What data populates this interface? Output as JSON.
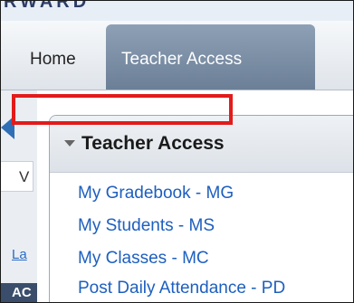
{
  "banner": {
    "text": "RWARD"
  },
  "nav": {
    "home_label": "Home",
    "teacher_access_label": "Teacher Access"
  },
  "left_column": {
    "tab_letter": "V",
    "link_fragment": "La",
    "bar_fragment": "AC"
  },
  "panel": {
    "title": "Teacher Access",
    "links": [
      {
        "label": "My Gradebook - MG"
      },
      {
        "label": "My Students - MS"
      },
      {
        "label": "My Classes - MC"
      },
      {
        "label": "Post Daily Attendance - PD"
      }
    ],
    "highlighted_index": 1
  },
  "colors": {
    "link": "#1d5fbf",
    "active_tab": "#7d91a8",
    "highlight_border": "#e21b1b"
  }
}
